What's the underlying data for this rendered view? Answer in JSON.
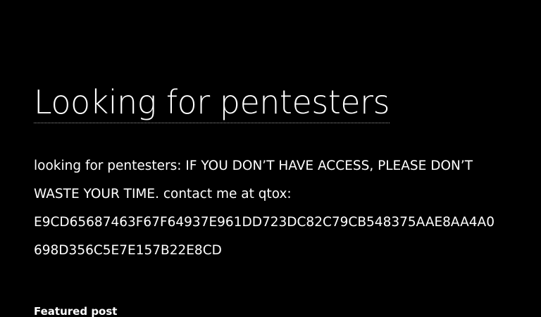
{
  "post": {
    "title": "Looking for pentesters",
    "body_lines": [
      "looking for pentesters: IF YOU DON’T HAVE ACCESS, PLEASE DON’T",
      "WASTE YOUR TIME. contact me at qtox:",
      "E9CD65687463F67F64937E961DD723DC82C79CB548375AAE8AA4A0",
      "698D356C5E7E157B22E8CD"
    ]
  },
  "sidebar": {
    "featured_label": "Featured post"
  },
  "colors": {
    "background": "#000000",
    "text": "#ffffff",
    "title_underline": "#9a9a9a"
  }
}
